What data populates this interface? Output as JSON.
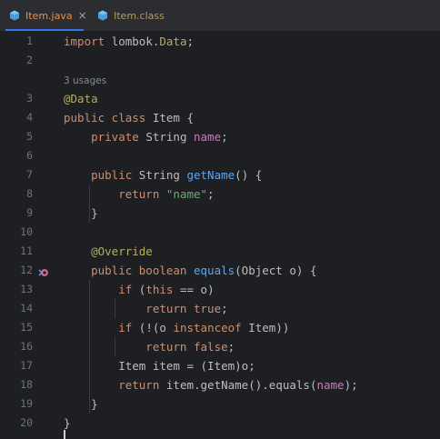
{
  "tabs": [
    {
      "label": "Item.java",
      "icon": "java-class-icon",
      "active": true,
      "close": "×"
    },
    {
      "label": "Item.class",
      "icon": "java-class-icon",
      "active": false
    }
  ],
  "editor": {
    "usages_hint": "3 usages",
    "line_numbers": [
      "1",
      "2",
      "3",
      "4",
      "5",
      "6",
      "7",
      "8",
      "9",
      "10",
      "11",
      "12",
      "13",
      "14",
      "15",
      "16",
      "17",
      "18",
      "19",
      "20"
    ],
    "lines": {
      "l1": [
        {
          "t": "import ",
          "c": "kw"
        },
        {
          "t": "lombok.",
          "c": "pkg"
        },
        {
          "t": "Data",
          "c": "ann"
        },
        {
          "t": ";",
          "c": "ident"
        }
      ],
      "l2": [],
      "l3": [
        {
          "t": "@Data",
          "c": "ann"
        }
      ],
      "l4": [
        {
          "t": "public class ",
          "c": "kw"
        },
        {
          "t": "Item {",
          "c": "ident"
        }
      ],
      "l5": [
        {
          "t": "    private ",
          "c": "kw"
        },
        {
          "t": "String ",
          "c": "ident"
        },
        {
          "t": "name",
          "c": "field"
        },
        {
          "t": ";",
          "c": "ident"
        }
      ],
      "l6": [],
      "l7": [
        {
          "t": "    public ",
          "c": "kw"
        },
        {
          "t": "String ",
          "c": "ident"
        },
        {
          "t": "getName",
          "c": "fn"
        },
        {
          "t": "() {",
          "c": "ident"
        }
      ],
      "l8": [
        {
          "t": "        return ",
          "c": "kw"
        },
        {
          "t": "\"name\"",
          "c": "str"
        },
        {
          "t": ";",
          "c": "ident"
        }
      ],
      "l9": [
        {
          "t": "    }",
          "c": "ident"
        }
      ],
      "l10": [],
      "l11": [
        {
          "t": "    @Override",
          "c": "ann"
        }
      ],
      "l12": [
        {
          "t": "    public boolean ",
          "c": "kw"
        },
        {
          "t": "equals",
          "c": "fn"
        },
        {
          "t": "(Object o) {",
          "c": "ident"
        }
      ],
      "l13": [
        {
          "t": "        if ",
          "c": "kw"
        },
        {
          "t": "(",
          "c": "ident"
        },
        {
          "t": "this",
          "c": "kw"
        },
        {
          "t": " == o)",
          "c": "ident"
        }
      ],
      "l14": [
        {
          "t": "            return true",
          "c": "kw"
        },
        {
          "t": ";",
          "c": "ident"
        }
      ],
      "l15": [
        {
          "t": "        if ",
          "c": "kw"
        },
        {
          "t": "(!(o ",
          "c": "ident"
        },
        {
          "t": "instanceof ",
          "c": "kw"
        },
        {
          "t": "Item))",
          "c": "ident"
        }
      ],
      "l16": [
        {
          "t": "            return false",
          "c": "kw"
        },
        {
          "t": ";",
          "c": "ident"
        }
      ],
      "l17": [
        {
          "t": "        Item item = (Item)o;",
          "c": "ident"
        }
      ],
      "l18": [
        {
          "t": "        return ",
          "c": "kw"
        },
        {
          "t": "item.",
          "c": "ident"
        },
        {
          "t": "getName",
          "c": "ident"
        },
        {
          "t": "().",
          "c": "ident"
        },
        {
          "t": "equals",
          "c": "ident"
        },
        {
          "t": "(",
          "c": "ident"
        },
        {
          "t": "name",
          "c": "field"
        },
        {
          "t": ");",
          "c": "ident"
        }
      ],
      "l19": [
        {
          "t": "    }",
          "c": "ident"
        }
      ],
      "l20": [
        {
          "t": "}",
          "c": "ident"
        }
      ]
    },
    "gutter_icons": [
      {
        "line": "12",
        "icon": "override-method-icon"
      }
    ]
  },
  "colors": {
    "background": "#1e1f22",
    "tab_active_underline": "#3574f0",
    "keyword": "#cf8e6d",
    "annotation": "#b3ae60",
    "function": "#56a8f5",
    "string": "#6aab73",
    "field": "#c77dbb"
  }
}
